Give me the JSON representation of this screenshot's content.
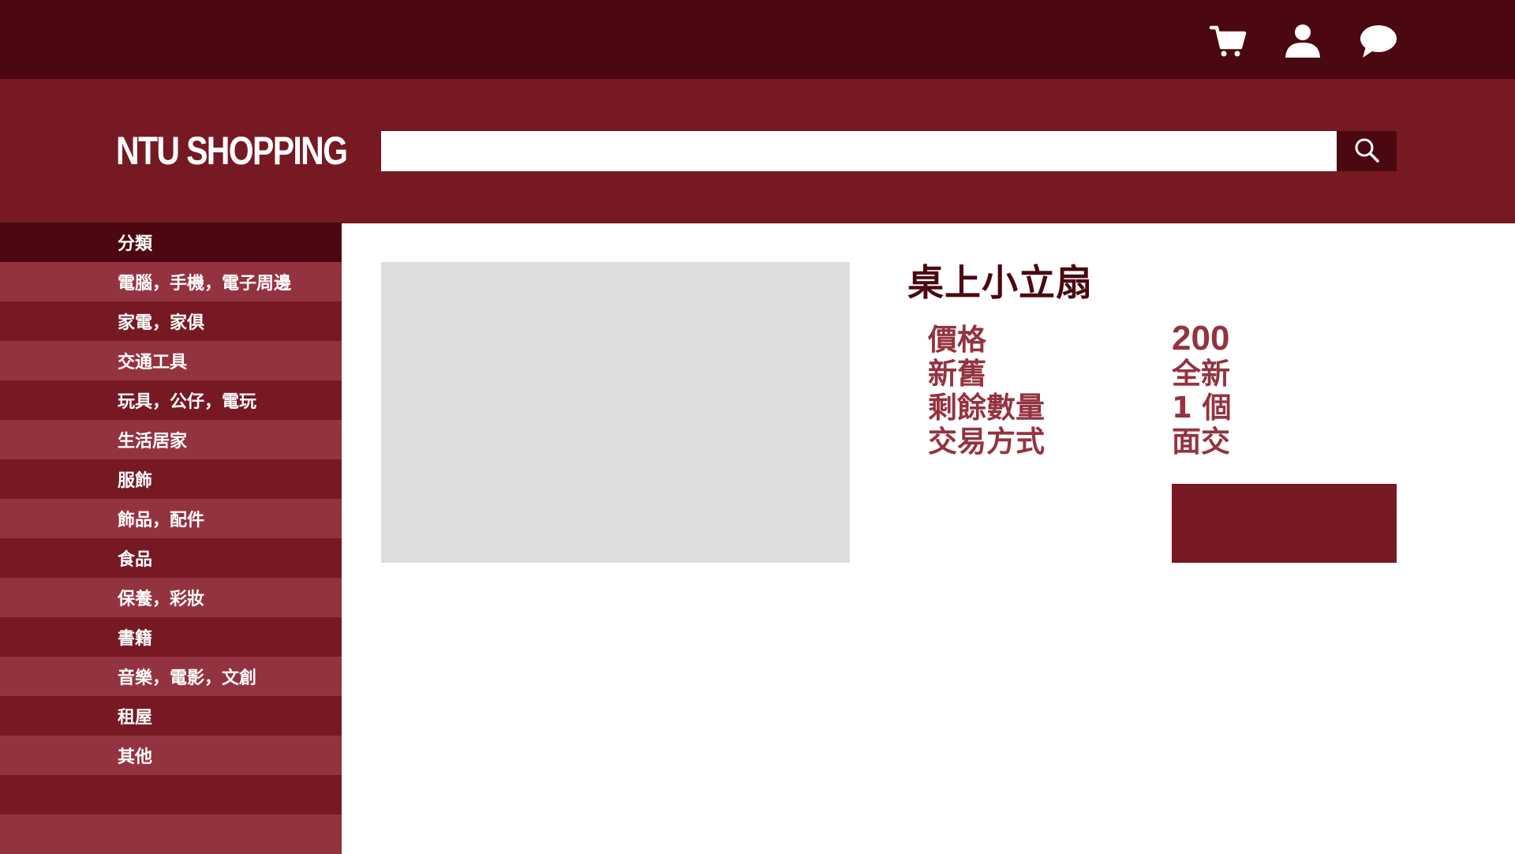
{
  "topbar": {
    "icons": [
      "cart-icon",
      "user-icon",
      "chat-icon"
    ],
    "background": "#4b0810"
  },
  "header": {
    "logo": "NTU SHOPPING",
    "search": {
      "value": "",
      "placeholder": ""
    },
    "background": "#761923"
  },
  "sidebar": {
    "heading": "分類",
    "items": [
      {
        "label": "電腦，手機，電子周邊"
      },
      {
        "label": "家電，家俱"
      },
      {
        "label": "交通工具"
      },
      {
        "label": "玩具，公仔，電玩"
      },
      {
        "label": "生活居家"
      },
      {
        "label": "服飾"
      },
      {
        "label": "飾品，配件"
      },
      {
        "label": "食品"
      },
      {
        "label": "保養，彩妝"
      },
      {
        "label": "書籍"
      },
      {
        "label": "音樂，電影，文創"
      },
      {
        "label": "租屋"
      },
      {
        "label": "其他"
      }
    ]
  },
  "product": {
    "title": "桌上小立扇",
    "details": [
      {
        "label": "價格",
        "value": "200"
      },
      {
        "label": "新舊",
        "value": "全新"
      },
      {
        "label": "剩餘數量",
        "value": "1 個"
      },
      {
        "label": "交易方式",
        "value": "面交"
      }
    ],
    "button_label": ""
  },
  "colors": {
    "dark": "#4b0810",
    "primary": "#761923",
    "light": "#943340",
    "image_placeholder": "#dddddd"
  }
}
